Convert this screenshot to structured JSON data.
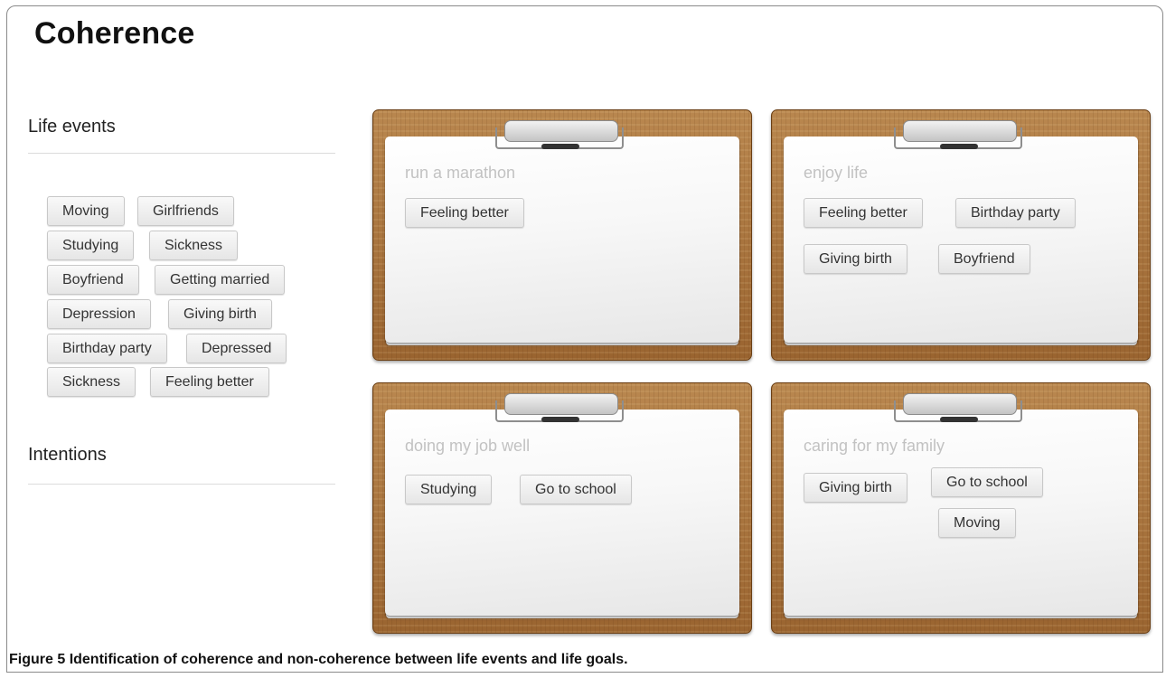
{
  "title": "Coherence",
  "life_events": {
    "heading": "Life events",
    "items": [
      "Moving",
      "Girlfriends",
      "Studying",
      "Sickness",
      "Boyfriend",
      "Getting married",
      "Depression",
      "Giving birth",
      "Birthday party",
      "Depressed",
      "Sickness",
      "Feeling better"
    ]
  },
  "intentions": {
    "heading": "Intentions"
  },
  "goals": [
    {
      "label": "run a marathon",
      "items": [
        "Feeling better"
      ]
    },
    {
      "label": "enjoy life",
      "items": [
        "Feeling better",
        "Birthday party",
        "Giving birth",
        "Boyfriend"
      ]
    },
    {
      "label": "doing my job well",
      "items": [
        "Studying",
        "Go to school"
      ]
    },
    {
      "label": "caring for my family",
      "items": [
        "Giving birth",
        "Go to school",
        "Moving"
      ]
    }
  ],
  "caption": {
    "figure": "Figure 5",
    "text": "Identification of coherence and non-coherence between life events and life goals."
  }
}
